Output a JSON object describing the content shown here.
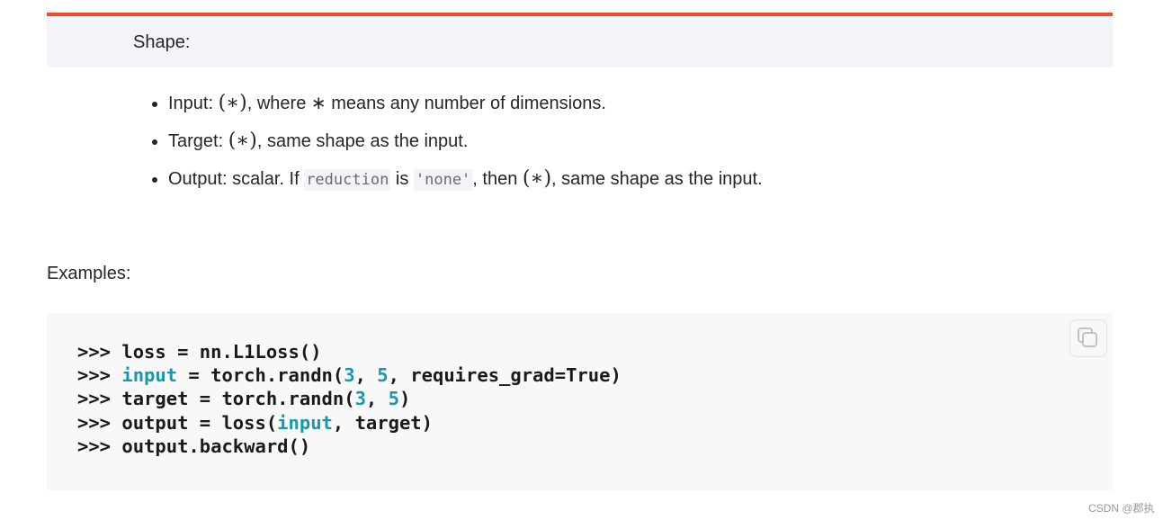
{
  "shape": {
    "heading": "Shape:",
    "items": [
      {
        "label": "Input: ",
        "math": "(∗)",
        "rest": ", where ∗ means any number of dimensions."
      },
      {
        "label": "Target: ",
        "math": "(∗)",
        "rest": ", same shape as the input."
      },
      {
        "label": "Output: scalar. If ",
        "code1": "reduction",
        "mid": " is ",
        "code2": "'none'",
        "then": ", then ",
        "math": "(∗)",
        "rest": ", same shape as the input."
      }
    ]
  },
  "examples": {
    "heading": "Examples:",
    "lines": [
      [
        ">>> loss = nn.L1Loss()"
      ],
      [
        ">>> ",
        "input",
        " = torch.randn(",
        "3",
        ", ",
        "5",
        ", requires_grad=True)"
      ],
      [
        ">>> target = torch.randn(",
        "3",
        ", ",
        "5",
        ")"
      ],
      [
        ">>> output = loss(",
        "input",
        ", target)"
      ],
      [
        ">>> output.backward()"
      ]
    ]
  },
  "accent_color": "#ee4c2c",
  "copy_icon": "copy-icon",
  "watermark": "CSDN @郡执"
}
